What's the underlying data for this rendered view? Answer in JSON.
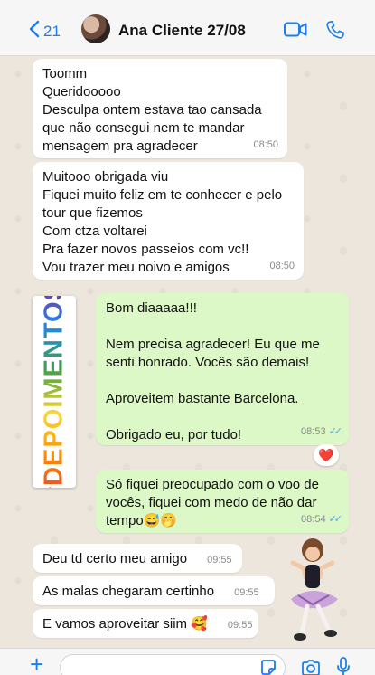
{
  "header": {
    "back_count": "21",
    "contact_name": "Ana Cliente 27/08",
    "icons": [
      "chevron-left-icon",
      "video-call-icon",
      "phone-icon"
    ]
  },
  "sticker_story": {
    "text": "#DEPOIMENTOS"
  },
  "messages": [
    {
      "direction": "incoming",
      "lines": [
        "Toomm",
        "Queridooooo",
        "Desculpa ontem estava tao cansada",
        "que não consegui nem te mandar",
        "mensagem pra agradecer"
      ],
      "time": "08:50"
    },
    {
      "direction": "incoming",
      "lines": [
        "Muitooo obrigada viu",
        "Fiquei muito feliz em te conhecer e pelo",
        "tour que fizemos",
        "Com ctza voltarei",
        "Pra fazer novos passeios com vc!!",
        "Vou trazer meu noivo e amigos"
      ],
      "time": "08:50"
    },
    {
      "direction": "outgoing",
      "lines": [
        "Bom diaaaaa!!!",
        "",
        "Nem precisa agradecer!  Eu que me",
        "senti honrado. Vocês são demais!",
        "",
        "Aproveitem bastante Barcelona.",
        "",
        "Obrigado eu, por tudo!"
      ],
      "time": "08:53",
      "reaction": "❤️"
    },
    {
      "direction": "outgoing",
      "lines": [
        "Só fiquei preocupado com o voo de",
        "vocês, fiquei com medo de não dar",
        "tempo😅🤭"
      ],
      "time": "08:54"
    },
    {
      "direction": "incoming",
      "lines": [
        "Deu td certo meu amigo"
      ],
      "time": "09:55"
    },
    {
      "direction": "incoming",
      "lines": [
        "As malas chegaram certinho"
      ],
      "time": "09:55"
    },
    {
      "direction": "incoming",
      "lines": [
        "E vamos aproveitar siim 🥰"
      ],
      "time": "09:55"
    }
  ],
  "read_ticks": "✓✓",
  "colors": {
    "accent": "#1a7ef2",
    "incoming_bubble": "#ffffff",
    "outgoing_bubble": "#dcf8c6",
    "chat_background": "#ece6dd",
    "read_ticks": "#4fa8e8"
  }
}
